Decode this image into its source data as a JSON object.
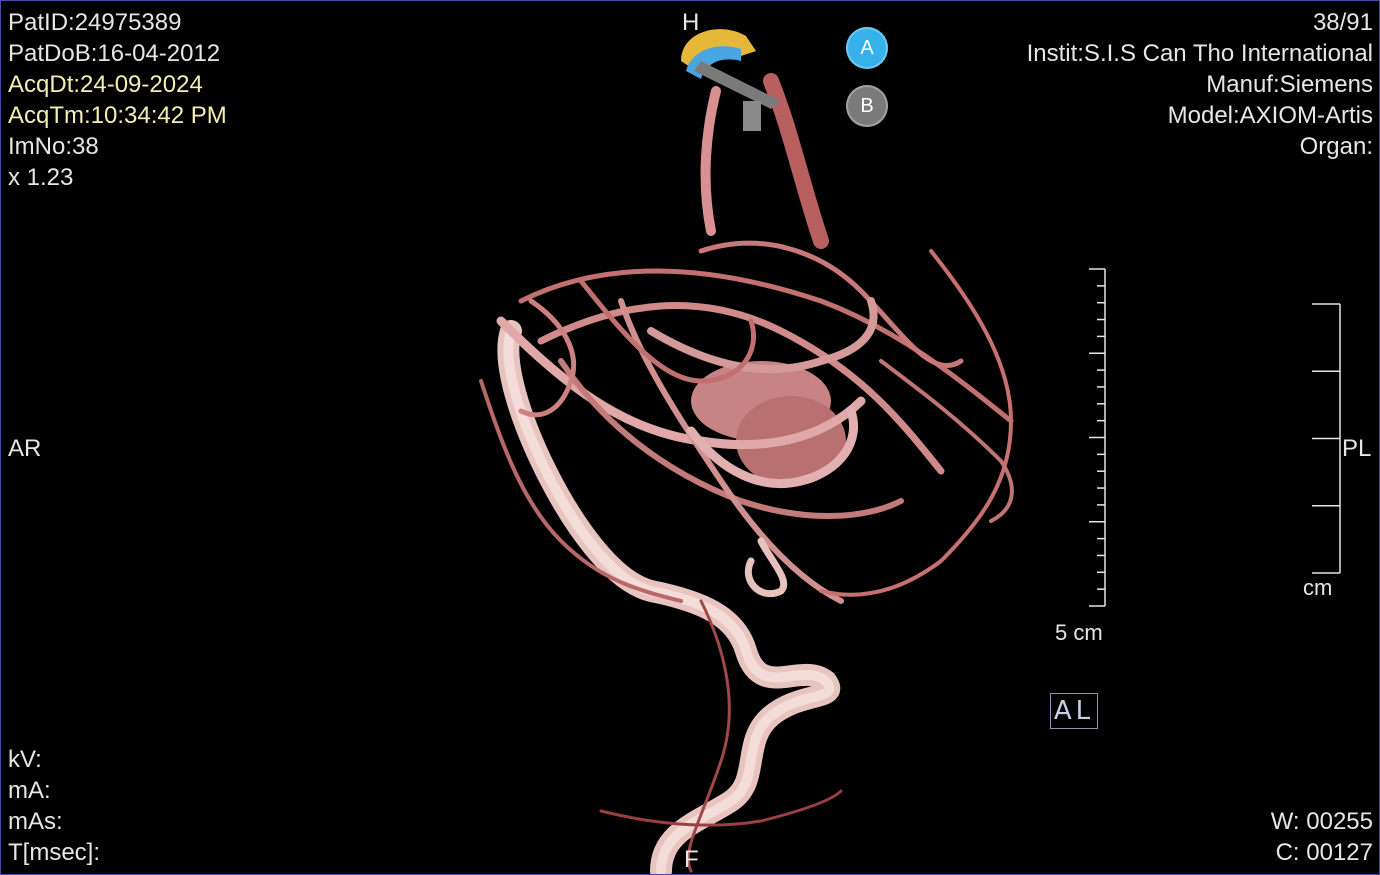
{
  "patient": {
    "id_line": "PatID:24975389",
    "dob_line": "PatDoB:16-04-2012",
    "acq_date_line": "AcqDt:24-09-2024",
    "acq_time_line": "AcqTm:10:34:42 PM",
    "image_number_line": "ImNo:38",
    "zoom_line": "x 1.23"
  },
  "device": {
    "frame_counter": "38/91",
    "institution_line": "Instit:S.I.S Can Tho International",
    "manufacturer_line": "Manuf:Siemens",
    "model_line": "Model:AXIOM-Artis",
    "organ_line": "Organ:"
  },
  "exposure": {
    "kv_line": "kV:",
    "ma_line": "mA:",
    "mas_line": "mAs:",
    "time_line": "T[msec]:"
  },
  "window": {
    "width_line": "W: 00255",
    "center_line": "C: 00127"
  },
  "orientation": {
    "top": "H",
    "bottom": "F",
    "left": "AR",
    "right": "PL"
  },
  "markers": {
    "a_label": "A",
    "b_label": "B"
  },
  "scales": {
    "left_label": "5 cm",
    "right_label": "cm"
  },
  "al_indicator": "AL",
  "colors": {
    "text": "#e6e6e6",
    "yellow_text": "#f3efb0",
    "vessel": "#c87a7a",
    "marker_a": "#37b1ea",
    "marker_b": "#7a7a7a",
    "border": "#4a4aa8"
  }
}
